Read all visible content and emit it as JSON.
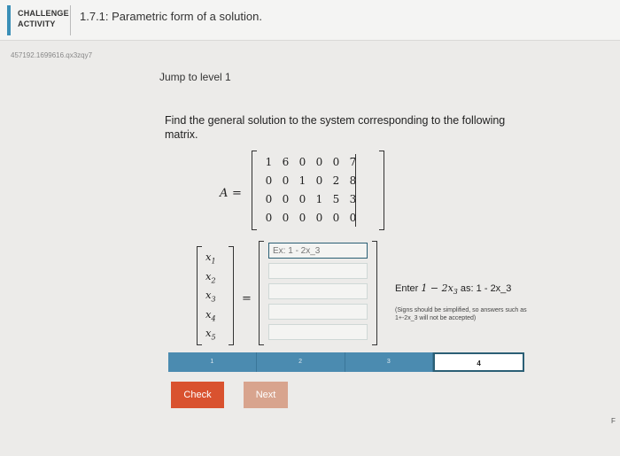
{
  "header": {
    "badge_line1": "CHALLENGE",
    "badge_line2": "ACTIVITY",
    "title": "1.7.1: Parametric form of a solution.",
    "activity_id": "457192.1699616.qx3zqy7"
  },
  "jump_link": "Jump to level 1",
  "prompt": "Find the general solution to the system corresponding to the following matrix.",
  "matrix": {
    "label": "A",
    "equals": "=",
    "rows": [
      [
        "1",
        "6",
        "0",
        "0",
        "0",
        "7"
      ],
      [
        "0",
        "0",
        "1",
        "0",
        "2",
        "8"
      ],
      [
        "0",
        "0",
        "0",
        "1",
        "5",
        "3"
      ],
      [
        "0",
        "0",
        "0",
        "0",
        "0",
        "0"
      ]
    ]
  },
  "vector": {
    "vars": [
      {
        "base": "x",
        "sub": "1"
      },
      {
        "base": "x",
        "sub": "2"
      },
      {
        "base": "x",
        "sub": "3"
      },
      {
        "base": "x",
        "sub": "4"
      },
      {
        "base": "x",
        "sub": "5"
      }
    ],
    "equals": "="
  },
  "answers": {
    "first_placeholder": "Ex: 1 - 2x_3",
    "fields": [
      "",
      "",
      "",
      "",
      ""
    ]
  },
  "hint": {
    "prefix": "Enter ",
    "math": "1 − 2x",
    "math_sub": "3",
    "as": " as: ",
    "example": "1 - 2x_3",
    "note": "(Signs should be simplified, so answers such as 1+-2x_3 will not be accepted)"
  },
  "progress": {
    "levels": [
      "1",
      "2",
      "3",
      "4"
    ],
    "current": 4
  },
  "buttons": {
    "check": "Check",
    "next": "Next"
  },
  "edge_text": "F",
  "colors": {
    "accent": "#3a8fb7",
    "progress": "#4b8bb0",
    "check": "#d9522f",
    "next": "#d8a48e"
  }
}
